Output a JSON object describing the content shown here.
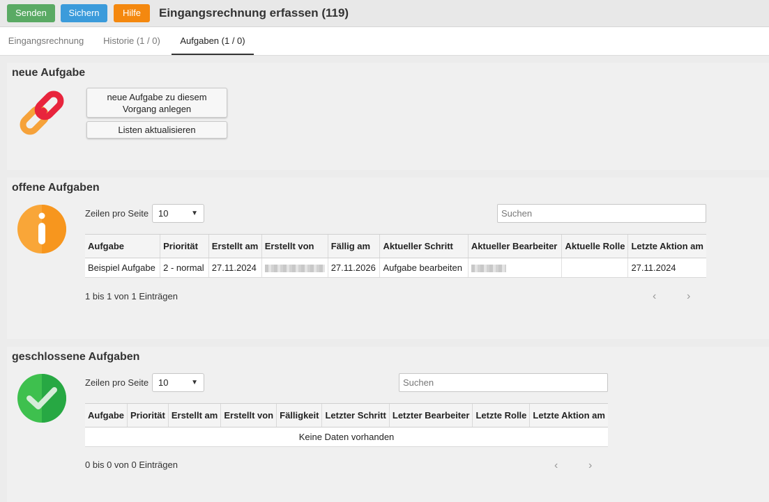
{
  "toolbar": {
    "send_label": "Senden",
    "save_label": "Sichern",
    "help_label": "Hilfe",
    "title": "Eingangsrechnung erfassen (119)",
    "colors": {
      "send": "#5aaa64",
      "save": "#3b9bdb",
      "help": "#f4880f"
    }
  },
  "tabs": [
    {
      "label": "Eingangsrechnung"
    },
    {
      "label": "Historie (1 / 0)"
    },
    {
      "label": "Aufgaben (1 / 0)",
      "active": true
    }
  ],
  "new_task": {
    "title": "neue Aufgabe",
    "icon": "link-icon",
    "create_line1": "neue Aufgabe zu diesem",
    "create_line2": "Vorgang anlegen",
    "refresh_label": "Listen aktualisieren"
  },
  "open_tasks": {
    "title": "offene Aufgaben",
    "icon": "info-icon",
    "rows_label": "Zeilen pro Seite",
    "rows_value": "10",
    "search_placeholder": "Suchen",
    "columns": [
      "Aufgabe",
      "Priorität",
      "Erstellt am",
      "Erstellt von",
      "Fällig am",
      "Aktueller Schritt",
      "Aktueller Bearbeiter",
      "Aktuelle Rolle",
      "Letzte Aktion am"
    ],
    "rows": [
      {
        "aufgabe": "Beispiel Aufgabe",
        "prioritaet": "2 - normal",
        "erstellt_am": "27.11.2024",
        "faellig_am": "27.11.2026",
        "schritt": "Aufgabe bearbeiten",
        "rolle": "",
        "letzte_aktion": "27.11.2024"
      }
    ],
    "info": "1 bis 1 von 1 Einträgen"
  },
  "closed_tasks": {
    "title": "geschlossene Aufgaben",
    "icon": "check-icon",
    "rows_label": "Zeilen pro Seite",
    "rows_value": "10",
    "search_placeholder": "Suchen",
    "columns": [
      "Aufgabe",
      "Priorität",
      "Erstellt am",
      "Erstellt von",
      "Fälligkeit",
      "Letzter Schritt",
      "Letzter Bearbeiter",
      "Letzte Rolle",
      "Letzte Aktion am"
    ],
    "empty": "Keine Daten vorhanden",
    "info": "0 bis 0 von 0 Einträgen"
  },
  "pager": {
    "prev": "‹",
    "next": "›"
  }
}
